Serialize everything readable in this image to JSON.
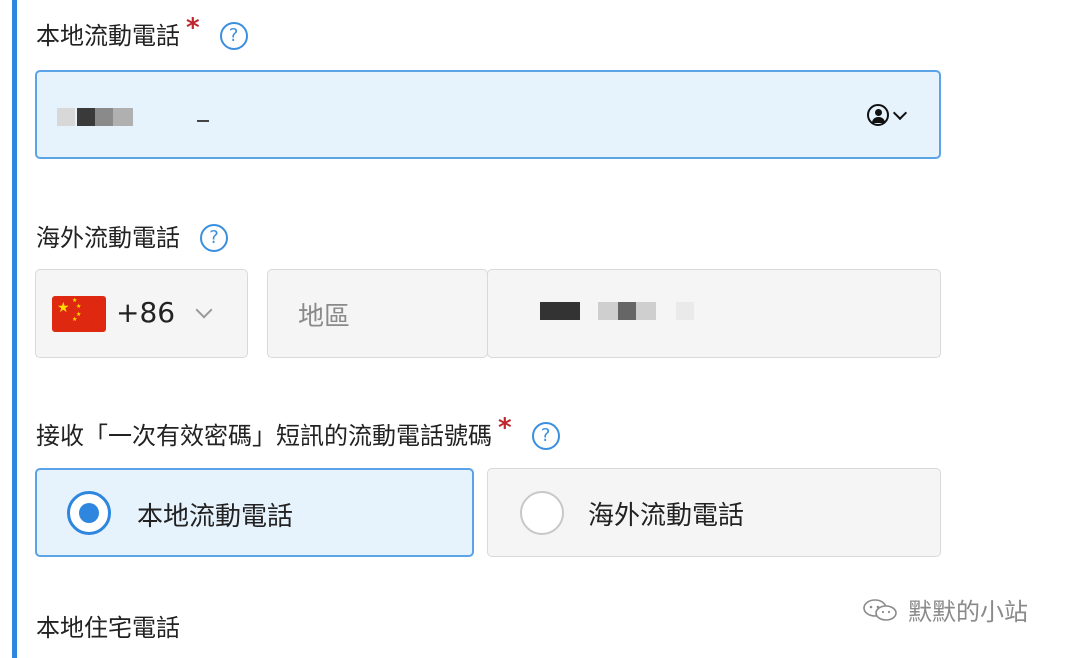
{
  "local_mobile": {
    "label": "本地流動電話",
    "required_mark": "*",
    "help_glyph": "?",
    "icons": [
      "contact-icon",
      "chevron-down-icon"
    ]
  },
  "overseas_mobile": {
    "label": "海外流動電話",
    "help_glyph": "?",
    "country_code": "+86",
    "country_flag": "china-flag-icon",
    "region_placeholder": "地區"
  },
  "otp_receiver": {
    "label": "接收「一次有效密碼」短訊的流動電話號碼",
    "required_mark": "*",
    "help_glyph": "?",
    "options": [
      {
        "label": "本地流動電話",
        "selected": true
      },
      {
        "label": "海外流動電話",
        "selected": false
      }
    ]
  },
  "local_home": {
    "label": "本地住宅電話"
  },
  "watermark": {
    "text": "默默的小站",
    "icon": "wechat-icon"
  },
  "colors": {
    "accent": "#2e86de",
    "required": "#c0262d",
    "active_bg": "#e6f2fc"
  }
}
